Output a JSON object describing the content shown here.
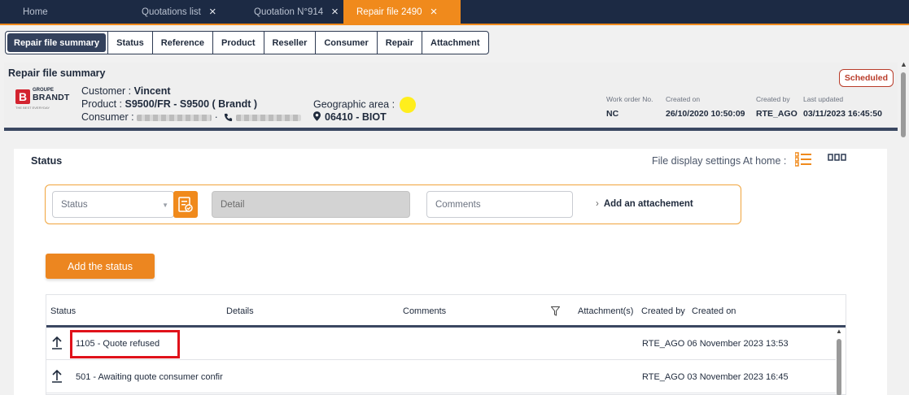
{
  "tabs": [
    {
      "label": "Home",
      "closable": false,
      "active": false
    },
    {
      "label": "Quotations list",
      "closable": true,
      "active": false
    },
    {
      "label": "Quotation N°914",
      "closable": true,
      "active": false
    },
    {
      "label": "Repair file 2490",
      "closable": true,
      "active": true
    }
  ],
  "tab_close_glyph": "×",
  "section_tabs": [
    "Repair file summary",
    "Status",
    "Reference",
    "Product",
    "Reseller",
    "Consumer",
    "Repair",
    "Attachment"
  ],
  "summary": {
    "title": "Repair file summary",
    "logo": {
      "small": "GROUPE",
      "big": "BRANDT",
      "tiny": "THE BEST EVERYDAY"
    },
    "customer_label": "Customer : ",
    "customer_value": "Vincent",
    "product_label": "Product : ",
    "product_value": "S9500/FR  -  S9500 ( Brandt )",
    "consumer_label": "Consumer : ",
    "geo_label": "Geographic area : ",
    "geo_value": "06410  -  BIOT",
    "work_order_label": "Work order No.",
    "work_order_value": "NC",
    "created_on_label": "Created on",
    "created_on_value": "26/10/2020 10:50:09",
    "created_by_label": "Created by",
    "created_by_value": "RTE_AGO",
    "last_updated_label": "Last updated",
    "last_updated_value": "03/11/2023 16:45:50",
    "status_badge": "Scheduled"
  },
  "status_panel": {
    "title": "Status",
    "display_settings": "File display settings At home :",
    "status_placeholder": "Status",
    "detail_placeholder": "Detail",
    "comments_placeholder": "Comments",
    "add_attachment": "Add an attachement",
    "add_button": "Add the status"
  },
  "table": {
    "headers": [
      "Status",
      "Details",
      "Comments",
      "Attachment(s)",
      "Created by",
      "Created on"
    ],
    "rows": [
      {
        "status": "1105 - Quote refused",
        "created": "RTE_AGO 06 November 2023 13:53"
      },
      {
        "status": "501 - Awaiting quote consumer confir",
        "created": "RTE_AGO 03 November 2023 16:45"
      }
    ]
  },
  "colors": {
    "accent": "#f08a1c",
    "navy": "#1c2a44",
    "highlight": "#e0121a",
    "badge": "#b93c2a"
  },
  "icons": [
    "close-icon",
    "phone-icon",
    "location-pin-icon",
    "status-list-icon",
    "list-view-icon",
    "grid-view-icon",
    "filter-icon",
    "arrow-up-icon"
  ]
}
